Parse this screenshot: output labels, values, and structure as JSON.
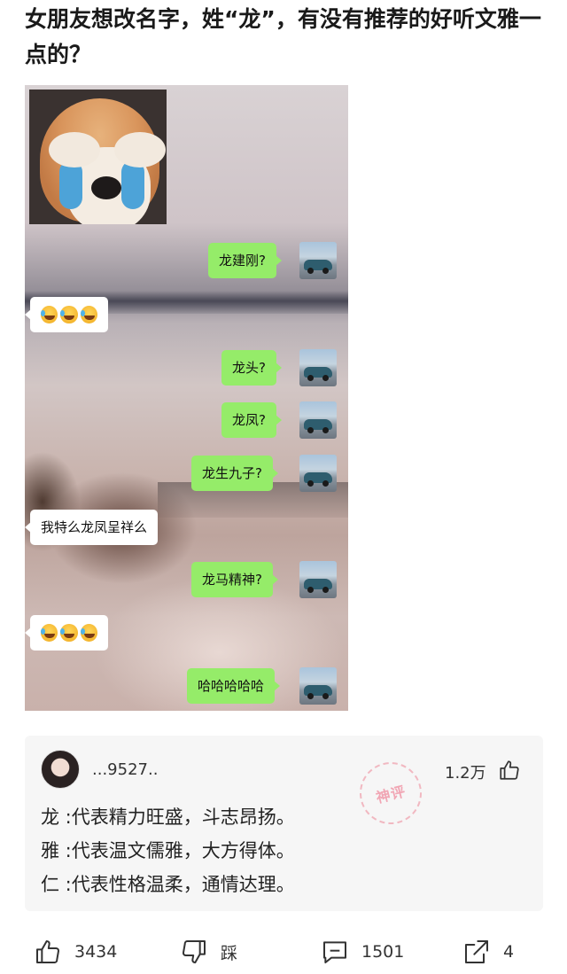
{
  "post": {
    "title": "女朋友想改名字，姓“龙”，有没有推荐的好听文雅一点的？"
  },
  "chat": {
    "messages": [
      {
        "side": "right",
        "text": "龙建刚?"
      },
      {
        "side": "left",
        "emoji": "laugh-cry-emoji x3"
      },
      {
        "side": "right",
        "text": "龙头?"
      },
      {
        "side": "right",
        "text": "龙凤?"
      },
      {
        "side": "right",
        "text": "龙生九子?"
      },
      {
        "side": "left",
        "text": "我特么龙凤呈祥么"
      },
      {
        "side": "right",
        "text": "龙马精神?"
      },
      {
        "side": "left",
        "emoji": "laugh-cry-emoji x3"
      },
      {
        "side": "right",
        "text": "哈哈哈哈哈"
      }
    ],
    "colors": {
      "outgoing_bubble": "#95ec69",
      "incoming_bubble": "#ffffff"
    }
  },
  "comment": {
    "username": "...9527..",
    "likes": "1.2万",
    "badge": "神评",
    "lines": [
      "龙 :代表精力旺盛，斗志昂扬。",
      "雅 :代表温文儒雅，大方得体。",
      "仁 :代表性格温柔，通情达理。"
    ]
  },
  "actions": {
    "like_count": "3434",
    "dislike_label": "踩",
    "comment_count": "1501",
    "share_count": "4"
  }
}
